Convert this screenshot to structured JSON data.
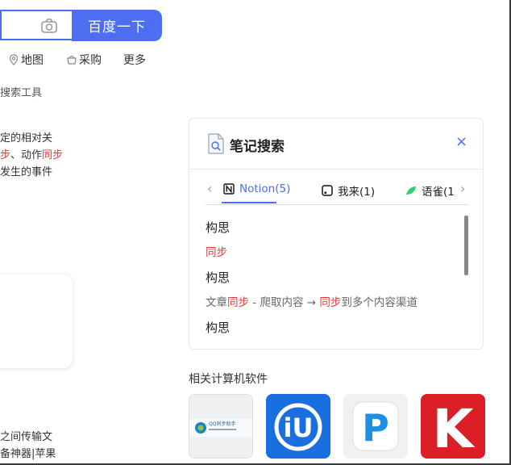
{
  "search": {
    "button_label": "百度一下"
  },
  "nav": {
    "map": "地图",
    "purchase": "采购",
    "more": "更多"
  },
  "tools_label": "搜索工具",
  "snippet": {
    "line1": "定的相对关",
    "line2_red1": "步",
    "line2_mid": "、动作",
    "line2_red2": "同步",
    "line3": "发生的事件"
  },
  "snippet_bottom": {
    "line1": "之间传输文",
    "line2": "备神器|苹果"
  },
  "note_card": {
    "title": "笔记搜索",
    "close": "×",
    "tabs": [
      {
        "label": "Notion(5)",
        "active": true
      },
      {
        "label": "我来(1)",
        "active": false
      },
      {
        "label": "语雀(1",
        "active": false
      }
    ],
    "results": [
      {
        "title": "构思",
        "desc_parts": [
          {
            "text": "同步",
            "red": true
          }
        ]
      },
      {
        "title": "构思",
        "desc_parts": [
          {
            "text": "文章",
            "red": false
          },
          {
            "text": "同步",
            "red": true
          },
          {
            "text": " - 爬取内容 → ",
            "red": false
          },
          {
            "text": "同步",
            "red": true
          },
          {
            "text": "到多个内容渠道",
            "red": false
          }
        ]
      },
      {
        "title": "构思"
      }
    ]
  },
  "related": {
    "title": "相关计算机软件"
  },
  "apps": [
    {
      "name": "QQ同步助手",
      "caption": "QQ同步助手"
    },
    {
      "name": "iU"
    },
    {
      "name": "P"
    },
    {
      "name": "K"
    }
  ],
  "colors": {
    "accent": "#4e6ef2",
    "red": "#e23b3b"
  }
}
